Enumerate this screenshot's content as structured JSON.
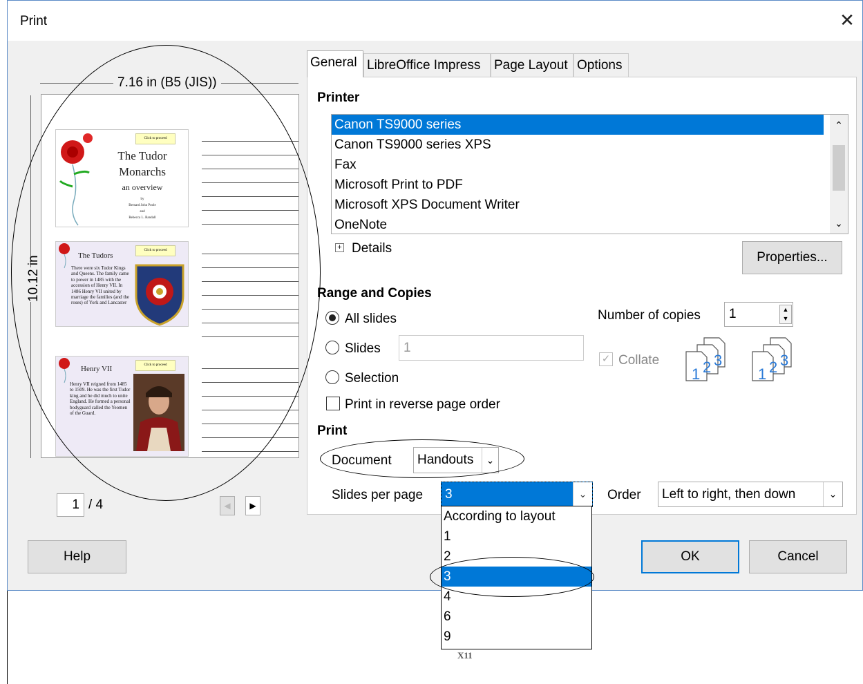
{
  "window": {
    "title": "Print",
    "close_glyph": "✕"
  },
  "preview": {
    "width_label": "7.16 in (B5 (JIS))",
    "height_label": "10.12 in",
    "page_current": "1",
    "page_total": "/ 4",
    "slides": [
      {
        "button": "Click to proceed",
        "title": "The Tudor Monarchs",
        "subtitle": "an overview",
        "author_lines": [
          "by",
          "Bernard John Poole",
          "and",
          "Rebecca L. Randall"
        ]
      },
      {
        "button": "Click to proceed",
        "title": "The Tudors",
        "body": "There were six Tudor Kings and Queens. The family came to power in 1485 with the accession of Henry VII. In 1486 Henry VII united by marriage the families (and the roses) of York and Lancaster"
      },
      {
        "button": "Click to proceed",
        "title": "Henry VII",
        "body": "Henry VII reigned from 1485 to 1509. He was the first Tudor king and he did much to unite England. He formed a personal bodyguard called the Yeomen of the Guard."
      }
    ]
  },
  "tabs": [
    {
      "label": "General",
      "active": true
    },
    {
      "label": "LibreOffice Impress",
      "active": false
    },
    {
      "label": "Page Layout",
      "active": false
    },
    {
      "label": "Options",
      "active": false
    }
  ],
  "printer": {
    "section_label": "Printer",
    "items": [
      "Canon TS9000 series",
      "Canon TS9000 series XPS",
      "Fax",
      "Microsoft Print to PDF",
      "Microsoft XPS Document Writer",
      "OneNote"
    ],
    "selected_index": 0,
    "details_label": "Details",
    "properties_label": "Properties..."
  },
  "range": {
    "section_label": "Range and Copies",
    "all_slides_label": "All slides",
    "slides_label": "Slides",
    "slides_value": "1",
    "selection_label": "Selection",
    "reverse_label": "Print in reverse page order",
    "copies_label": "Number of copies",
    "copies_value": "1",
    "collate_label": "Collate"
  },
  "print": {
    "section_label": "Print",
    "document_label": "Document",
    "document_value": "Handouts",
    "slides_per_page_label": "Slides per page",
    "slides_per_page_value": "3",
    "order_label": "Order",
    "order_value": "Left to right, then down",
    "dropdown_options": [
      "According to layout",
      "1",
      "2",
      "3",
      "4",
      "6",
      "9"
    ],
    "dropdown_selected_index": 3
  },
  "buttons": {
    "help": "Help",
    "ok": "OK",
    "cancel": "Cancel"
  },
  "background_text": "X11",
  "colors": {
    "selection": "#0078d7",
    "dialog_bg": "#f0f0f0",
    "title_border": "#5a8ac6"
  }
}
